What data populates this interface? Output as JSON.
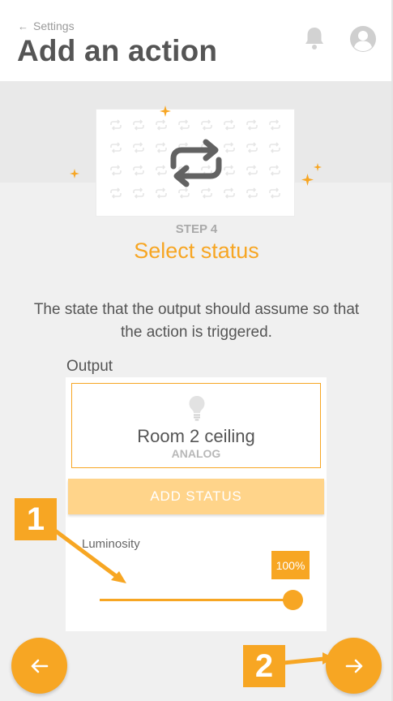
{
  "header": {
    "breadcrumb_label": "Settings",
    "title": "Add an action",
    "notification_icon": "bell-icon",
    "account_icon": "user-avatar-icon"
  },
  "illustration": {
    "icon": "repeat-arrows-icon"
  },
  "step": {
    "label": "STEP 4",
    "title": "Select status",
    "description": "The state that the output should assume so that the action is triggered."
  },
  "output": {
    "section_label": "Output",
    "icon": "lightbulb-icon",
    "name": "Room 2 ceiling",
    "type": "ANALOG"
  },
  "actions": {
    "add_status_label": "ADD STATUS"
  },
  "luminosity": {
    "label": "Luminosity",
    "value_display": "100%",
    "value_fraction": 1.0
  },
  "nav": {
    "back_icon": "arrow-left-icon",
    "next_icon": "arrow-right-icon"
  },
  "annotations": {
    "callout_1": "1",
    "callout_2": "2"
  },
  "colors": {
    "accent": "#f7a623",
    "accent_light": "#ffd48a",
    "text": "#555555",
    "muted": "#a9a9a9",
    "background": "#f0f0f0"
  }
}
